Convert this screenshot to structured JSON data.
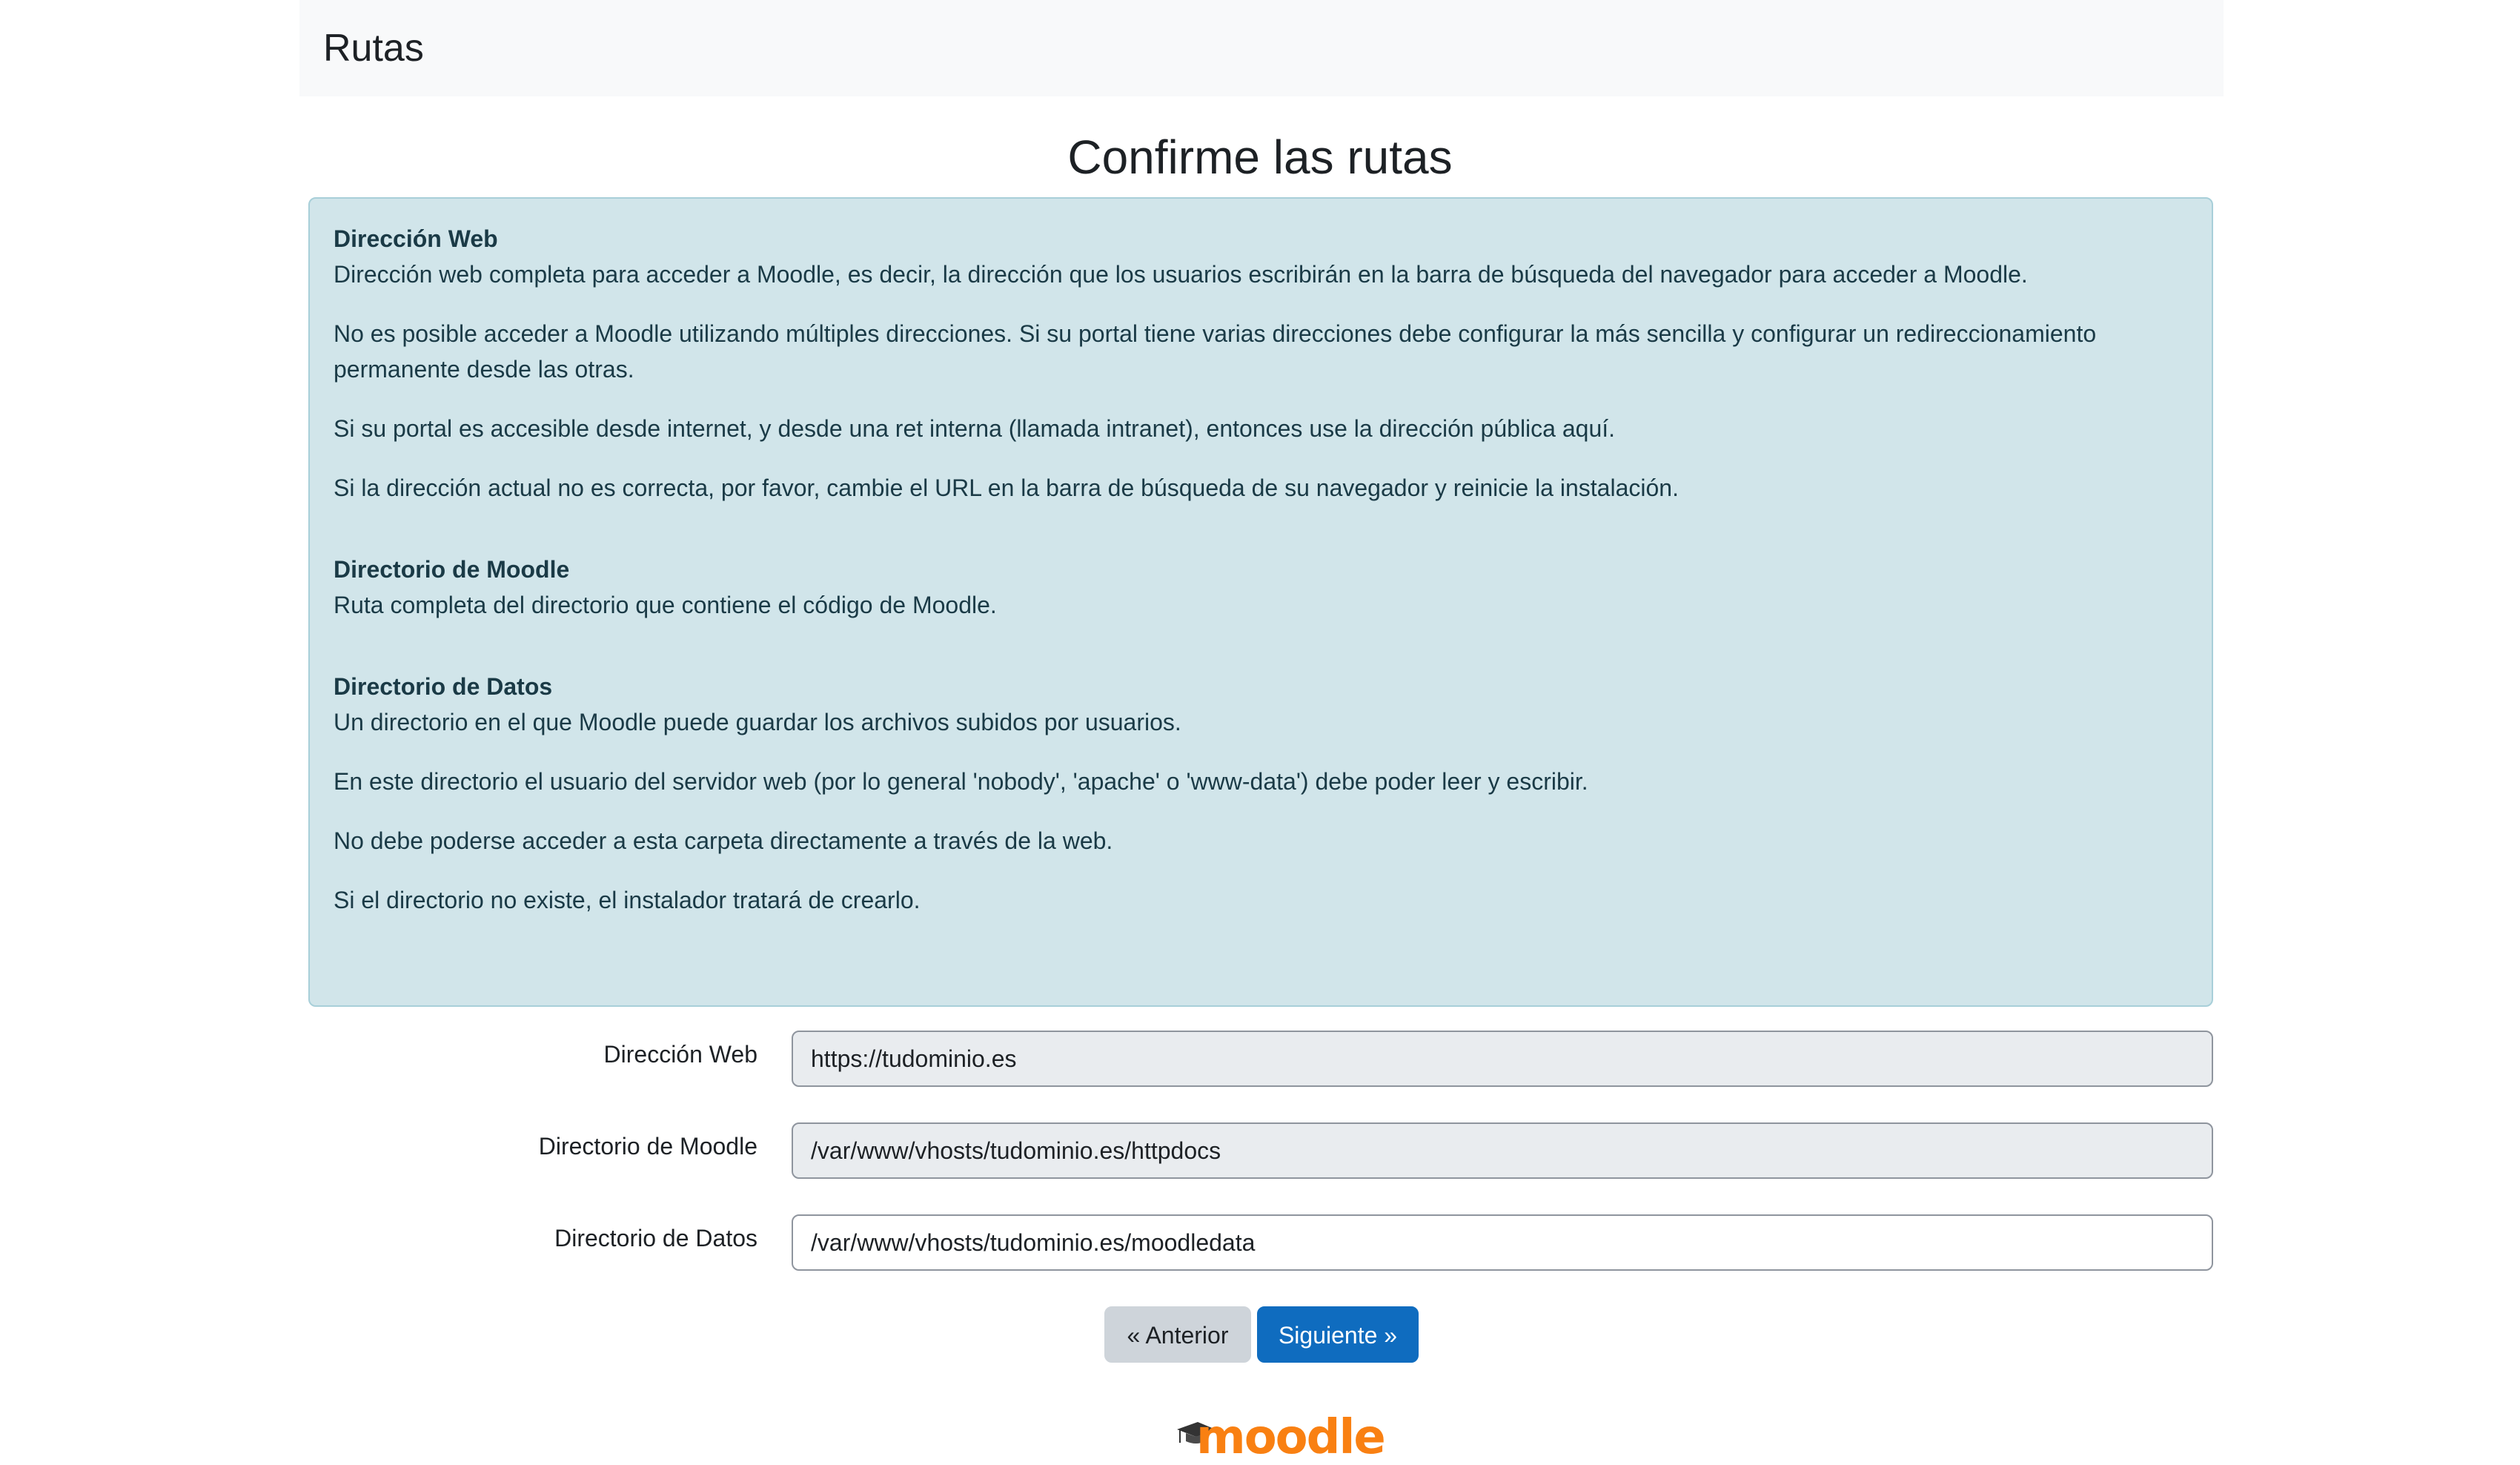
{
  "header": {
    "title": "Rutas"
  },
  "main": {
    "heading": "Confirme las rutas"
  },
  "info": {
    "web": {
      "title": "Dirección Web",
      "paragraphs": [
        "Dirección web completa para acceder a Moodle, es decir, la dirección que los usuarios escribirán en la barra de búsqueda del navegador para acceder a Moodle.",
        "No es posible acceder a Moodle utilizando múltiples direcciones. Si su portal tiene varias direcciones debe configurar la más sencilla y configurar un redireccionamiento permanente desde las otras.",
        "Si su portal es accesible desde internet, y desde una ret interna (llamada intranet), entonces use la dirección pública aquí.",
        "Si la dirección actual no es correcta, por favor, cambie el URL en la barra de búsqueda de su navegador y reinicie la instalación."
      ]
    },
    "moodle_dir": {
      "title": "Directorio de Moodle",
      "paragraphs": [
        "Ruta completa del directorio que contiene el código de Moodle."
      ]
    },
    "data_dir": {
      "title": "Directorio de Datos",
      "paragraphs": [
        "Un directorio en el que Moodle puede guardar los archivos subidos por usuarios.",
        "En este directorio el usuario del servidor web (por lo general 'nobody', 'apache' o 'www-data') debe poder leer y escribir.",
        "No debe poderse acceder a esta carpeta directamente a través de la web.",
        "Si el directorio no existe, el instalador tratará de crearlo."
      ]
    }
  },
  "form": {
    "web_label": "Dirección Web",
    "web_value": "https://tudominio.es",
    "moodle_label": "Directorio de Moodle",
    "moodle_value": "/var/www/vhosts/tudominio.es/httpdocs",
    "data_label": "Directorio de Datos",
    "data_value": "/var/www/vhosts/tudominio.es/moodledata"
  },
  "buttons": {
    "prev_label": "« Anterior",
    "next_label": "Siguiente »"
  },
  "footer": {
    "logo_text": "moodle",
    "logo_icon": "graduation-cap-icon"
  },
  "colors": {
    "info_bg": "#d1e5ea",
    "info_border": "#a8cfd9",
    "primary": "#0f6cbf",
    "secondary": "#ced4da",
    "logo_orange": "#f98012"
  }
}
